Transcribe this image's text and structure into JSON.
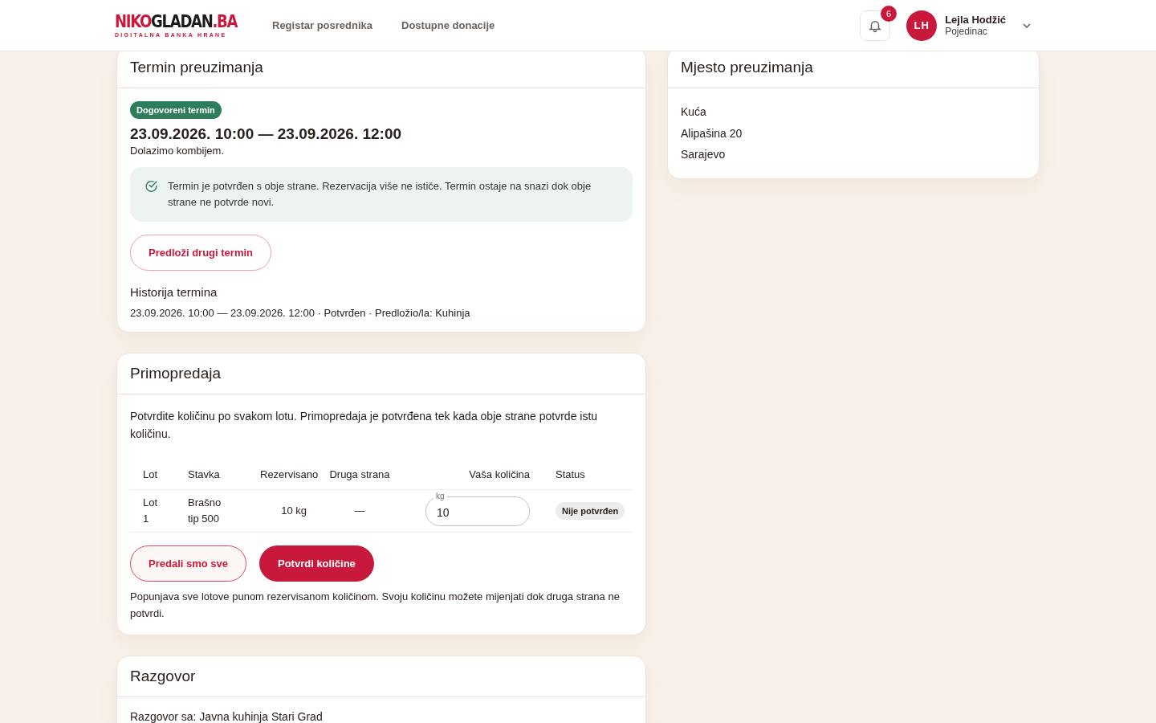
{
  "header": {
    "logo": {
      "accent_start": "NIKO",
      "middle": "GLADAN",
      "accent_end": ".BA",
      "tagline": "DIGITALNA BANKA HRANE"
    },
    "nav": [
      {
        "label": "Registar posrednika",
        "selected": false
      },
      {
        "label": "Dostupne donacije",
        "selected": false
      }
    ],
    "notifications": {
      "count": "6"
    },
    "user": {
      "initials": "LH",
      "name": "Lejla Hodžić",
      "role": "Pojedinac"
    }
  },
  "term_card": {
    "title": "Termin preuzimanja",
    "badge": "Dogovoreni termin",
    "range": "23.09.2026. 10:00 — 23.09.2026. 12:00",
    "note": "Dolazimo kombijem.",
    "alert": "Termin je potvrđen s obje strane. Rezervacija više ne ističe. Termin ostaje na snazi dok obje strane ne potvrde novi.",
    "button": "Predloži drugi termin",
    "history_title": "Historija termina",
    "history": [
      "23.09.2026. 10:00 — 23.09.2026. 12:00 · Potvrđen · Predložio/la: Kuhinja"
    ]
  },
  "place_card": {
    "title": "Mjesto preuzimanja",
    "lines": [
      "Kuća",
      "Alipašina 20",
      "Sarajevo"
    ]
  },
  "handover_card": {
    "title": "Primopredaja",
    "intro": "Potvrdite količinu po svakom lotu. Primopredaja je potvrđena tek kada obje strane potvrde istu količinu.",
    "table": {
      "columns": [
        "Lot",
        "Stavka",
        "Rezervisano",
        "Druga strana",
        "Vaša količina",
        "Status"
      ],
      "rows": [
        {
          "lot": "Lot 1",
          "item": "Brašno tip 500",
          "reserved": "10 kg",
          "other": "—",
          "quantity": {
            "label": "kg",
            "value": "10"
          },
          "status": "Nije potvrđen"
        }
      ]
    },
    "buttons": [
      {
        "label": "Predali smo sve",
        "kind": "secondary"
      },
      {
        "label": "Potvrdi količine",
        "kind": "primary"
      }
    ],
    "hint": "Popunjava sve lotove punom rezervisanom količinom. Svoju količinu možete mijenjati dok druga strana ne potvrdi."
  },
  "chat_card": {
    "title": "Razgovor",
    "subtitle": "Razgovor sa: Javna kuhinja Stari Grad"
  }
}
